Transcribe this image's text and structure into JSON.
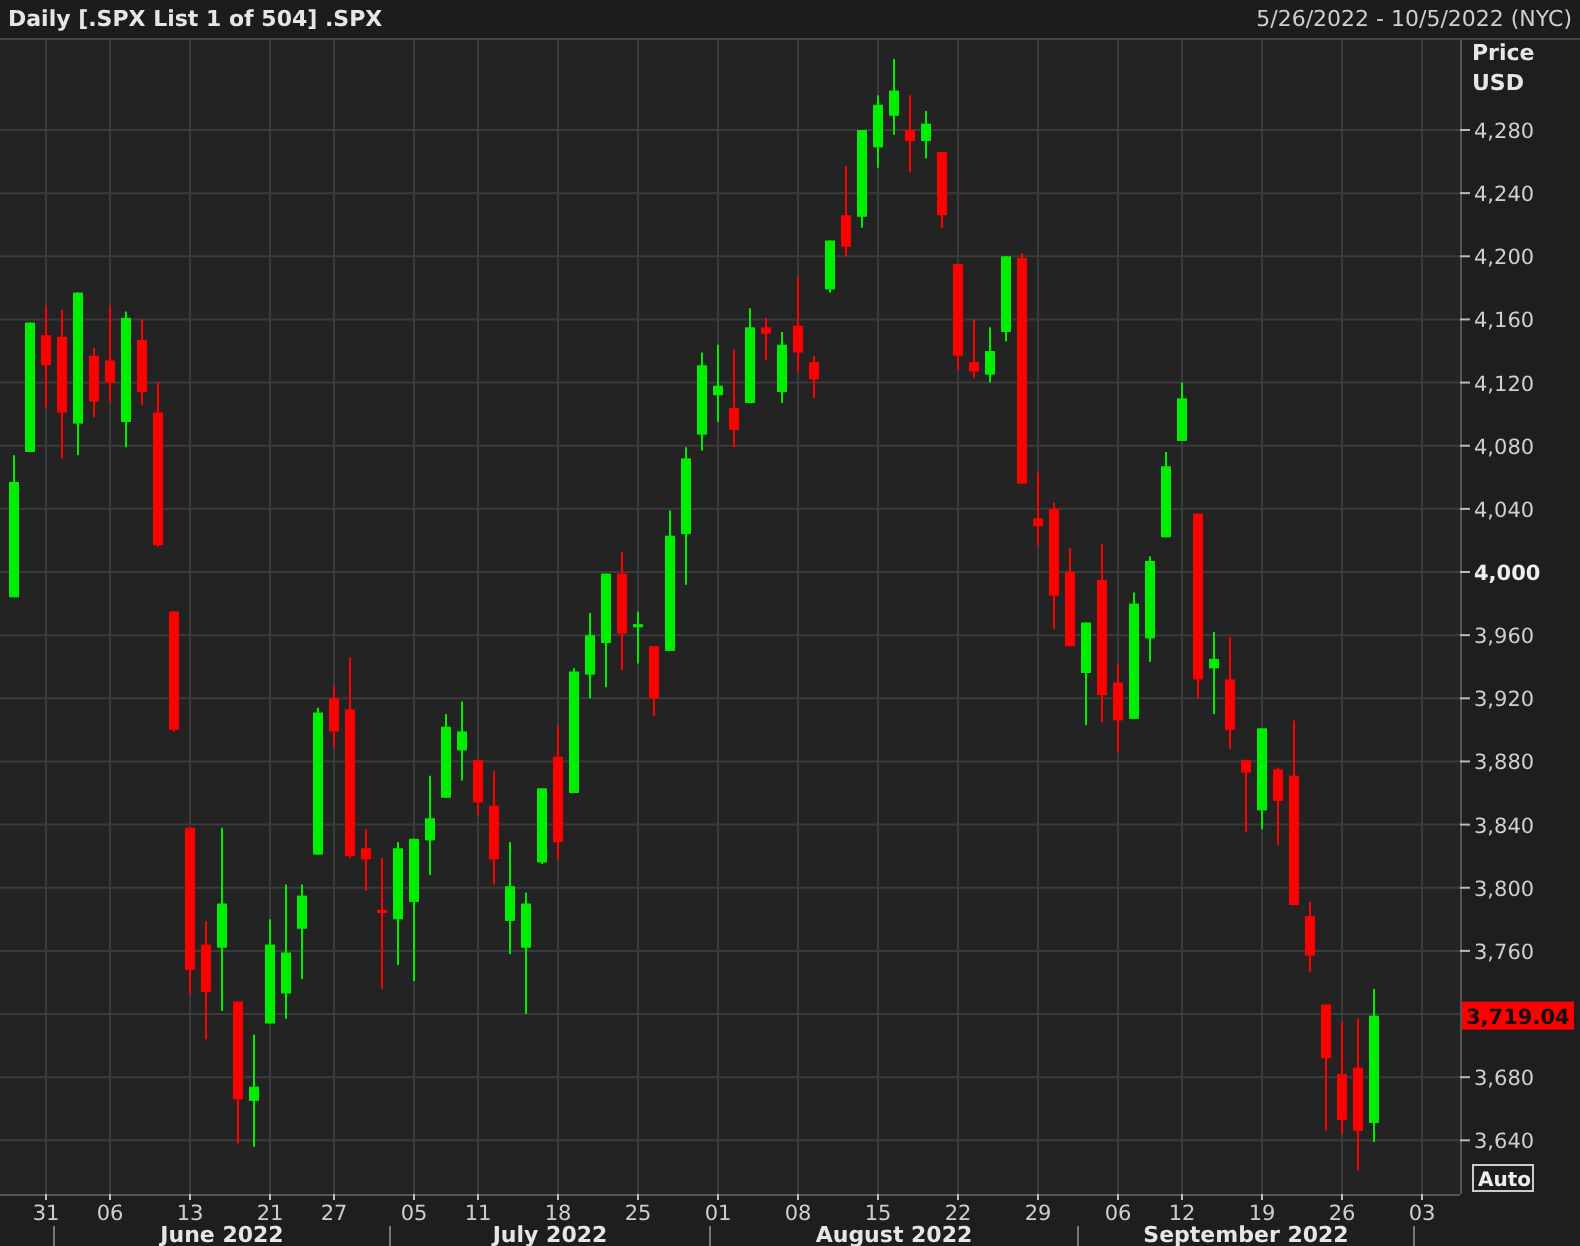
{
  "header": {
    "title": "Daily [.SPX List 1 of 504] .SPX",
    "date_range": "5/26/2022 - 10/5/2022 (NYC)"
  },
  "chart": {
    "chart_data": {
      "type": "candlestick",
      "ylabel": "Price USD",
      "grid": true,
      "ylim": [
        3606,
        4337
      ],
      "yticks": [
        {
          "value": 3640,
          "label": "3,640"
        },
        {
          "value": 3680,
          "label": "3,680"
        },
        {
          "value": 3760,
          "label": "3,760"
        },
        {
          "value": 3800,
          "label": "3,800"
        },
        {
          "value": 3840,
          "label": "3,840"
        },
        {
          "value": 3880,
          "label": "3,880"
        },
        {
          "value": 3920,
          "label": "3,920"
        },
        {
          "value": 3960,
          "label": "3,960"
        },
        {
          "value": 4000,
          "label": "4,000"
        },
        {
          "value": 4040,
          "label": "4,040"
        },
        {
          "value": 4080,
          "label": "4,080"
        },
        {
          "value": 4120,
          "label": "4,120"
        },
        {
          "value": 4160,
          "label": "4,160"
        },
        {
          "value": 4200,
          "label": "4,200"
        },
        {
          "value": 4240,
          "label": "4,240"
        },
        {
          "value": 4280,
          "label": "4,280"
        }
      ],
      "categories": [
        null,
        null,
        "31",
        null,
        null,
        null,
        "06",
        null,
        null,
        null,
        null,
        "13",
        null,
        null,
        null,
        null,
        "21",
        null,
        null,
        null,
        "27",
        null,
        null,
        null,
        null,
        "05",
        null,
        null,
        null,
        "11",
        null,
        null,
        null,
        null,
        "18",
        null,
        null,
        null,
        null,
        "25",
        null,
        null,
        null,
        null,
        "01",
        null,
        null,
        null,
        null,
        "08",
        null,
        null,
        null,
        null,
        "15",
        null,
        null,
        null,
        null,
        "22",
        null,
        null,
        null,
        null,
        "29",
        null,
        null,
        null,
        null,
        "06",
        null,
        null,
        null,
        "12",
        null,
        null,
        null,
        null,
        "19",
        null,
        null,
        null,
        null,
        "26",
        null,
        null,
        null,
        null,
        "03"
      ],
      "ohlc": [
        [
          3984,
          4074,
          3984,
          4057
        ],
        [
          4076,
          4158,
          4076,
          4158
        ],
        [
          4150,
          4169,
          4104,
          4131
        ],
        [
          4149,
          4166,
          4072,
          4101
        ],
        [
          4094,
          4177,
          4074,
          4177
        ],
        [
          4137,
          4142,
          4098,
          4108
        ],
        [
          4134,
          4169,
          4108,
          4120
        ],
        [
          4095,
          4165,
          4079,
          4161
        ],
        [
          4147,
          4160,
          4106,
          4114
        ],
        [
          4101,
          4120,
          4016,
          4017
        ],
        [
          3975,
          3975,
          3899,
          3900
        ],
        [
          3838,
          3838,
          3733,
          3748
        ],
        [
          3764,
          3779,
          3704,
          3734
        ],
        [
          3762,
          3838,
          3722,
          3790
        ],
        [
          3728,
          3728,
          3638,
          3666
        ],
        [
          3665,
          3707,
          3636,
          3674
        ],
        [
          3714,
          3780,
          3714,
          3764
        ],
        [
          3733,
          3802,
          3717,
          3759
        ],
        [
          3774,
          3802,
          3742,
          3795
        ],
        [
          3821,
          3914,
          3821,
          3911
        ],
        [
          3920,
          3928,
          3889,
          3899
        ],
        [
          3913,
          3946,
          3819,
          3820
        ],
        [
          3825,
          3837,
          3798,
          3818
        ],
        [
          3786,
          3819,
          3736,
          3784
        ],
        [
          3780,
          3829,
          3751,
          3825
        ],
        [
          3791,
          3831,
          3741,
          3831
        ],
        [
          3830,
          3871,
          3808,
          3844
        ],
        [
          3857,
          3910,
          3857,
          3902
        ],
        [
          3887,
          3918,
          3868,
          3899
        ],
        [
          3881,
          3881,
          3846,
          3854
        ],
        [
          3852,
          3874,
          3802,
          3818
        ],
        [
          3779,
          3829,
          3758,
          3801
        ],
        [
          3762,
          3797,
          3720,
          3790
        ],
        [
          3816,
          3863,
          3815,
          3863
        ],
        [
          3883,
          3903,
          3818,
          3829
        ],
        [
          3860,
          3939,
          3860,
          3937
        ],
        [
          3935,
          3974,
          3920,
          3960
        ],
        [
          3955,
          3999,
          3927,
          3999
        ],
        [
          3999,
          4013,
          3938,
          3961
        ],
        [
          3965,
          3975,
          3942,
          3967
        ],
        [
          3953,
          3953,
          3909,
          3920
        ],
        [
          3950,
          4039,
          3950,
          4023
        ],
        [
          4024,
          4079,
          3992,
          4072
        ],
        [
          4087,
          4139,
          4077,
          4131
        ],
        [
          4112,
          4144,
          4095,
          4118
        ],
        [
          4104,
          4141,
          4079,
          4090
        ],
        [
          4107,
          4167,
          4107,
          4155
        ],
        [
          4155,
          4161,
          4134,
          4151
        ],
        [
          4114,
          4152,
          4107,
          4144
        ],
        [
          4156,
          4187,
          4127,
          4139
        ],
        [
          4133,
          4137,
          4110,
          4122
        ],
        [
          4179,
          4210,
          4177,
          4210
        ],
        [
          4226,
          4257,
          4200,
          4206
        ],
        [
          4225,
          4280,
          4218,
          4280
        ],
        [
          4269,
          4302,
          4256,
          4296
        ],
        [
          4289,
          4325,
          4277,
          4305
        ],
        [
          4280,
          4302,
          4253,
          4273
        ],
        [
          4273,
          4292,
          4262,
          4284
        ],
        [
          4266,
          4266,
          4218,
          4226
        ],
        [
          4195,
          4195,
          4128,
          4137
        ],
        [
          4133,
          4160,
          4123,
          4127
        ],
        [
          4125,
          4155,
          4120,
          4140
        ],
        [
          4152,
          4200,
          4146,
          4200
        ],
        [
          4199,
          4202,
          4056,
          4056
        ],
        [
          4034,
          4063,
          4017,
          4029
        ],
        [
          4040,
          4044,
          3964,
          3985
        ],
        [
          4000,
          4015,
          3953,
          3953
        ],
        [
          3936,
          3968,
          3903,
          3968
        ],
        [
          3995,
          4018,
          3905,
          3922
        ],
        [
          3930,
          3942,
          3886,
          3906
        ],
        [
          3907,
          3987,
          3907,
          3980
        ],
        [
          3958,
          4010,
          3943,
          4007
        ],
        [
          4022,
          4076,
          4022,
          4067
        ],
        [
          4083,
          4120,
          4083,
          4110
        ],
        [
          4037,
          4037,
          3920,
          3932
        ],
        [
          3939,
          3962,
          3910,
          3945
        ],
        [
          3932,
          3959,
          3888,
          3900
        ],
        [
          3881,
          3881,
          3835,
          3873
        ],
        [
          3849,
          3901,
          3837,
          3901
        ],
        [
          3875,
          3876,
          3827,
          3855
        ],
        [
          3871,
          3906,
          3789,
          3789
        ],
        [
          3782,
          3791,
          3747,
          3757
        ],
        [
          3726,
          3726,
          3646,
          3692
        ],
        [
          3682,
          3715,
          3644,
          3653
        ],
        [
          3686,
          3717,
          3621,
          3646
        ],
        [
          3651,
          3736,
          3639,
          3719
        ],
        null,
        null,
        null
      ]
    },
    "month_labels": [
      "June 2022",
      "July 2022",
      "August 2022",
      "September 2022"
    ],
    "last_price": "3,719.04",
    "auto_button": "Auto"
  }
}
